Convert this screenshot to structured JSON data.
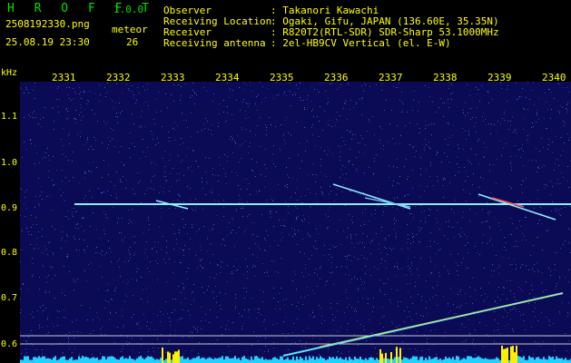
{
  "header": {
    "app_name": "H R O F F T",
    "version": "1.0.0",
    "filename": "2508192330.png",
    "datetime": "25.08.19 23:30",
    "meteor_label": "meteor",
    "meteor_count": "26",
    "info": [
      {
        "key": "Observer",
        "value": ": Takanori Kawachi"
      },
      {
        "key": "Receiving Location",
        "value": ": Ogaki, Gifu, JAPAN (136.60E, 35.35N)"
      },
      {
        "key": "Receiver",
        "value": ": R820T2(RTL-SDR) SDR-Sharp 53.1000MHz"
      },
      {
        "key": "Receiving antenna",
        "value": ": 2el-HB9CV Vertical (el. E-W)"
      }
    ]
  },
  "axis": {
    "unit": "kHz",
    "x_ticks": [
      "2331",
      "2332",
      "2333",
      "2334",
      "2335",
      "2336",
      "2337",
      "2338",
      "2339",
      "2340"
    ],
    "y_ticks": [
      "1.1",
      "1.0",
      "0.9",
      "0.8",
      "0.7",
      "0.6"
    ]
  },
  "colors": {
    "background": "#0b0b55",
    "label": "#ffff00",
    "title": "#00e000",
    "signal": "#8cf0ff"
  }
}
